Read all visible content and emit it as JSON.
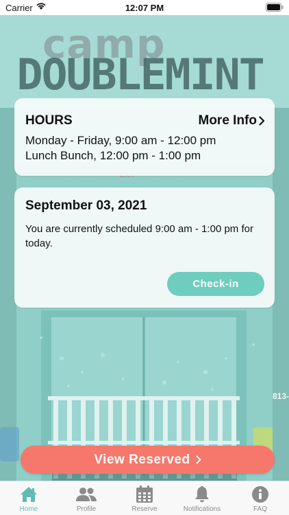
{
  "status_bar": {
    "carrier": "Carrier",
    "time": "12:07 PM"
  },
  "background": {
    "sign_line1": "camp",
    "sign_line2": "DOUBLEMINT",
    "exit_sign": "EXIT",
    "door_number": "813-"
  },
  "hours_card": {
    "title": "HOURS",
    "more_info_label": "More Info",
    "line1": "Monday - Friday, 9:00 am - 12:00 pm",
    "line2": "Lunch Bunch,     12:00 pm - 1:00 pm"
  },
  "schedule_card": {
    "date": "September 03, 2021",
    "message": "You are currently scheduled 9:00 am - 1:00 pm for today.",
    "checkin_label": "Check-in"
  },
  "view_reserved_label": "View Reserved",
  "tabs": [
    {
      "label": "Home",
      "icon": "home-icon",
      "active": true
    },
    {
      "label": "Profile",
      "icon": "people-icon",
      "active": false
    },
    {
      "label": "Reserve",
      "icon": "calendar-icon",
      "active": false
    },
    {
      "label": "Notifications",
      "icon": "bell-icon",
      "active": false
    },
    {
      "label": "FAQ",
      "icon": "info-icon",
      "active": false
    }
  ],
  "colors": {
    "accent_teal": "#6ecdbf",
    "reserved_coral": "#f6776c",
    "active_tab": "#5fbdb0",
    "inactive_tab": "#8a8a8a"
  }
}
